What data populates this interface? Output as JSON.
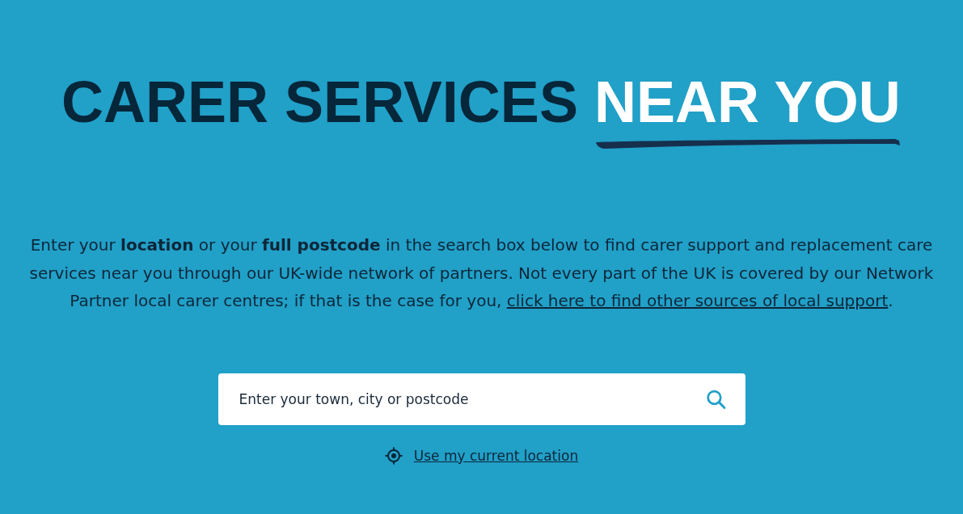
{
  "heading": {
    "text": "CARER SERVICES",
    "highlight": "NEAR YOU"
  },
  "intro": {
    "text": "Enter your **location** or your **full postcode** in the search box below to find carer support and replacement care services near you through our UK-wide network of partners. Not every part of the UK is covered by our Network Partner local carer centres; if that is the case for you, ",
    "link": "click here to find other sources of local support",
    "end": "."
  },
  "search": {
    "placeholder": "Enter your town, city or postcode"
  },
  "location_link": "Use my current location"
}
